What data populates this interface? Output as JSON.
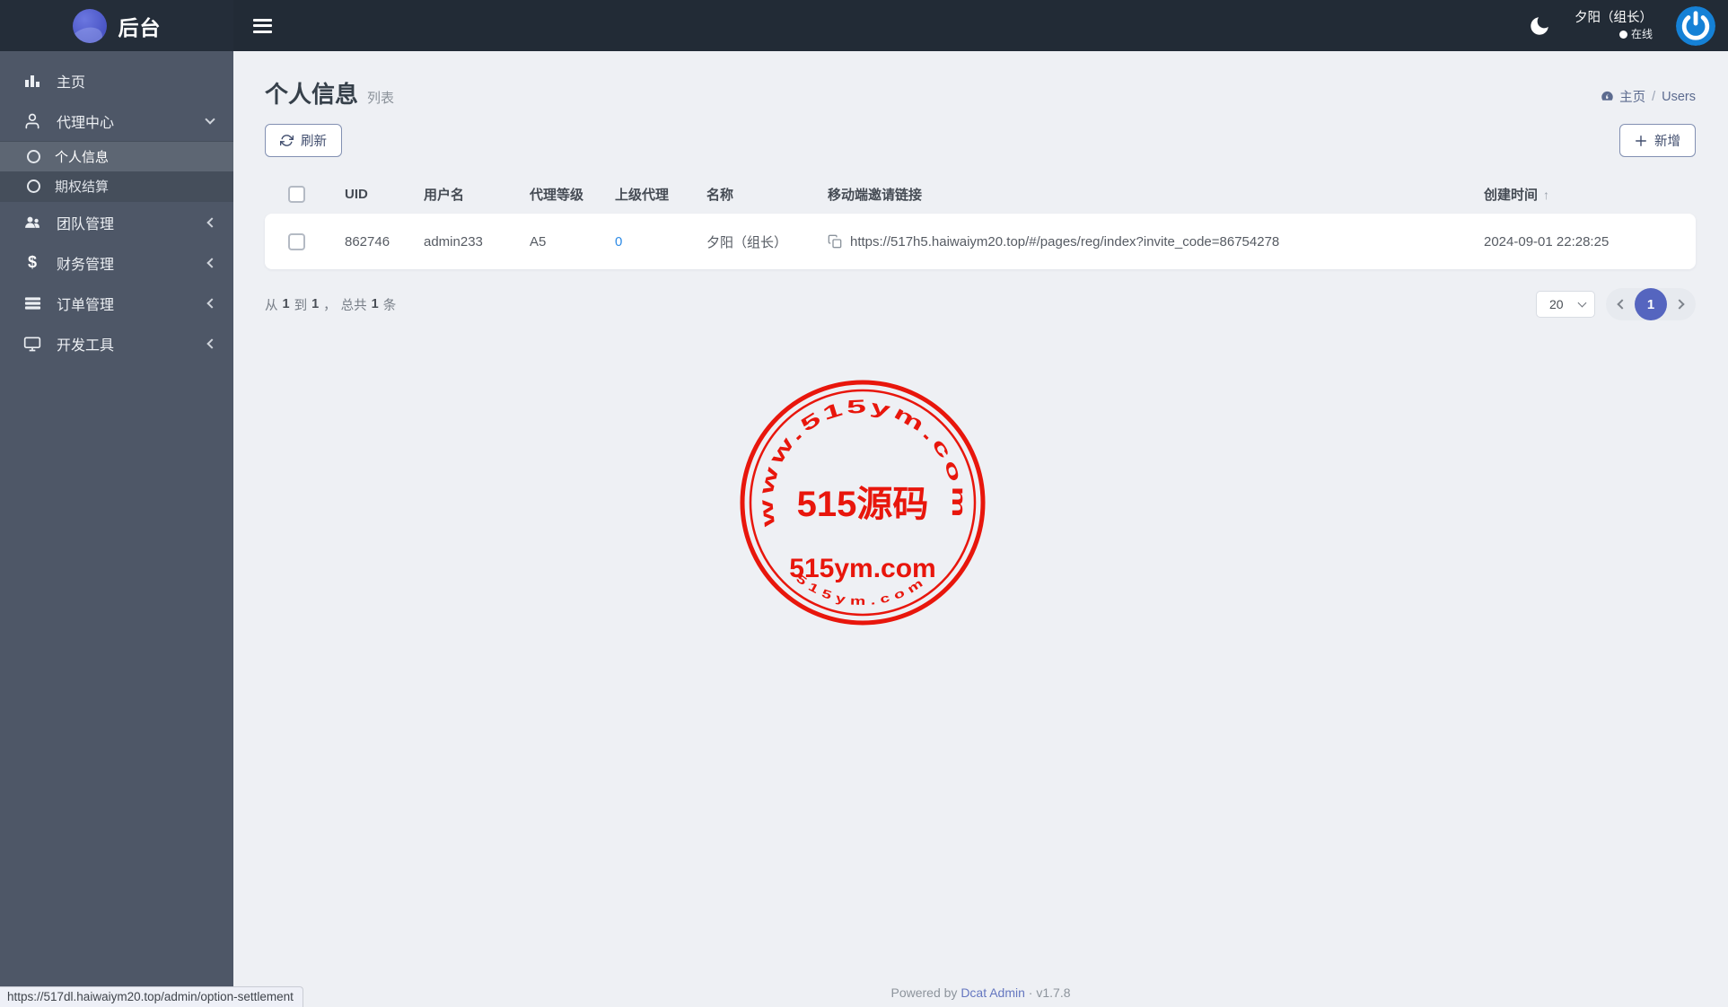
{
  "navbar": {
    "brand": "后台",
    "user_name": "夕阳（组长）",
    "online_label": "在线"
  },
  "sidebar": {
    "items": [
      {
        "label": "主页",
        "icon": "chart-bar-icon"
      },
      {
        "label": "代理中心",
        "icon": "user-icon",
        "expanded": true
      },
      {
        "label": "个人信息",
        "icon": "circle-icon",
        "active": true
      },
      {
        "label": "期权结算",
        "icon": "circle-icon"
      },
      {
        "label": "团队管理",
        "icon": "team-icon"
      },
      {
        "label": "财务管理",
        "icon": "dollar-icon"
      },
      {
        "label": "订单管理",
        "icon": "list-icon"
      },
      {
        "label": "开发工具",
        "icon": "devtools-icon"
      }
    ]
  },
  "page": {
    "title": "个人信息",
    "subtitle": "列表",
    "breadcrumb_home": "主页",
    "breadcrumb_sep": "/",
    "breadcrumb_current": "Users"
  },
  "toolbar": {
    "refresh_label": "刷新",
    "add_label": "新增"
  },
  "table": {
    "headers": {
      "uid": "UID",
      "username": "用户名",
      "agent_level": "代理等级",
      "parent_agent": "上级代理",
      "name": "名称",
      "invite_link": "移动端邀请链接",
      "created_at": "创建时间"
    },
    "sort_arrow": "↑",
    "row": {
      "uid": "862746",
      "username": "admin233",
      "agent_level": "A5",
      "parent_agent": "0",
      "name": "夕阳（组长）",
      "invite_link": "https://517h5.haiwaiym20.top/#/pages/reg/index?invite_code=86754278",
      "created_at": "2024-09-01 22:28:25"
    }
  },
  "pagination": {
    "from_label": "从",
    "from": "1",
    "to_label": "到",
    "to": "1",
    "comma": "，",
    "total_label": "总共",
    "total": "1",
    "unit_label": "条",
    "page_size": "20",
    "current_page": "1"
  },
  "watermark": {
    "top_text": "www.515ym.com",
    "title": "515源码",
    "subtitle": "515ym.com",
    "bottom_text": "515ym.com"
  },
  "footer": {
    "powered_by": "Powered by",
    "link": "Dcat Admin",
    "separator": "·",
    "version": "v1.7.8"
  },
  "status_bar": {
    "url": "https://517dl.haiwaiym20.top/admin/option-settlement"
  },
  "colors": {
    "accent": "#5565bf",
    "stamp_red": "#e8160c",
    "link_blue": "#2e8be6",
    "avatar_blue": "#1581d6",
    "sidebar_bg": "#4e5767",
    "navbar_bg": "#222b36"
  }
}
